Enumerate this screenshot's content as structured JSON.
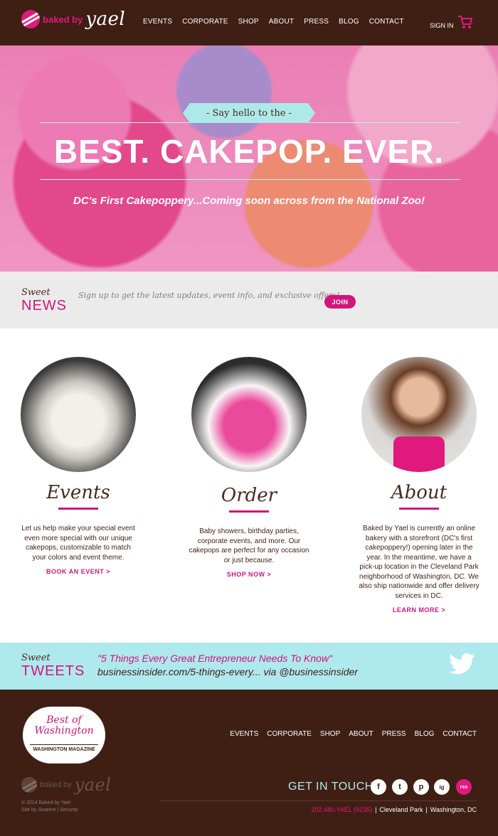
{
  "header": {
    "logo_text": "baked by",
    "logo_script": "yael",
    "nav": [
      "EVENTS",
      "CORPORATE",
      "SHOP",
      "ABOUT",
      "PRESS",
      "BLOG",
      "CONTACT"
    ],
    "signin": "SIGN IN",
    "cart_icon": "cart-icon"
  },
  "hero": {
    "banner": "- Say hello to the -",
    "title": "BEST. CAKEPOP. EVER.",
    "subtitle": "DC's First Cakepoppery...Coming soon across from the National Zoo!"
  },
  "news": {
    "sweet": "Sweet",
    "label": "NEWS",
    "text": "Sign up to get the latest updates, event info, and exclusive offers!",
    "join": "JOIN"
  },
  "columns": [
    {
      "title": "Events",
      "text": "Let us help make your special event even more special with our unique cakepops, customizable to match your colors and event theme.",
      "link": "BOOK AN EVENT >"
    },
    {
      "title": "Order",
      "text": "Baby showers, birthday parties, corporate events, and more. Our cakepops are perfect for any occasion or just because.",
      "link": "SHOP NOW >"
    },
    {
      "title": "About",
      "text": "Baked by Yael is currently an online bakery with a storefront (DC's first cakepoppery!) opening later in the year. In the meantime, we have a pick-up location in the Cleveland Park neighborhood of Washington, DC. We also ship nationwide and offer delivery services in DC.",
      "link": "LEARN MORE >"
    }
  ],
  "tweets": {
    "sweet": "Sweet",
    "label": "TWEETS",
    "quote": "\"5 Things Every Great Entrepreneur Needs To Know\"",
    "link": "businessinsider.com/5-things-every...",
    "via": "via @businessinsider"
  },
  "footer": {
    "badge_line1": "Best of",
    "badge_line2": "Washington",
    "badge_sub": "WASHINGTON MAGAZINE",
    "nav": [
      "EVENTS",
      "CORPORATE",
      "SHOP",
      "ABOUT",
      "PRESS",
      "BLOG",
      "CONTACT"
    ],
    "logo_text": "baked by",
    "logo_script": "yael",
    "copyright": "© 2014 Baked by Yael",
    "credit": "Site by Sisarine | Security",
    "get_in_touch": "GET IN TOUCH",
    "phone": "202.480.YAEL (9235)",
    "location": "Cleveland Park",
    "city": "Washington, DC",
    "social": [
      "f",
      "t",
      "p",
      "ig",
      "rss"
    ]
  },
  "colors": {
    "brown": "#3f1f14",
    "pink": "#d0167a",
    "aqua": "#aee9ee"
  }
}
